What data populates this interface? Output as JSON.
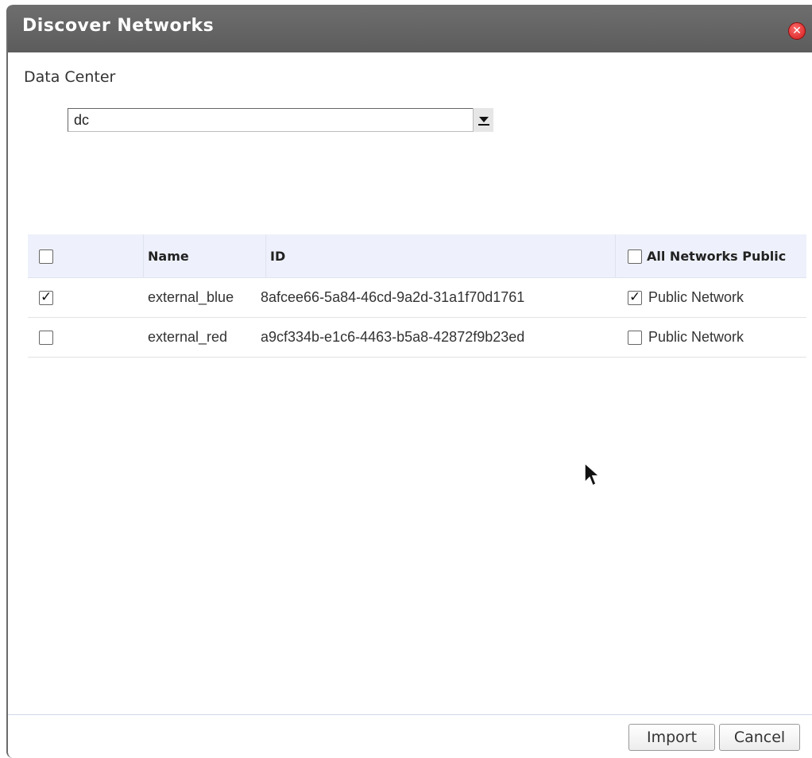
{
  "dialog": {
    "title": "Discover Networks",
    "close_icon": "close-icon"
  },
  "data_center": {
    "label": "Data Center",
    "selected": "dc"
  },
  "table": {
    "columns": {
      "select_all": "",
      "name": "Name",
      "id": "ID",
      "all_public": "All Networks Public"
    },
    "all_public_checked": false,
    "select_all_checked": false,
    "rows": [
      {
        "selected": true,
        "name": "external_blue",
        "id": "8afcee66-5a84-46cd-9a2d-31a1f70d1761",
        "public_label": "Public Network",
        "public_checked": true
      },
      {
        "selected": false,
        "name": "external_red",
        "id": "a9cf334b-e1c6-4463-b5a8-42872f9b23ed",
        "public_label": "Public Network",
        "public_checked": false
      }
    ]
  },
  "buttons": {
    "import": "Import",
    "cancel": "Cancel"
  }
}
